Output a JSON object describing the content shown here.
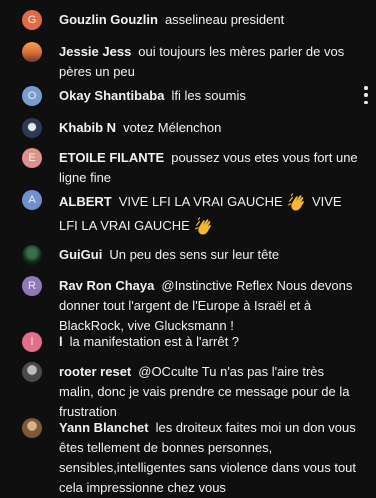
{
  "chat": {
    "messages": [
      {
        "author": "Gouzlin Gouzlin",
        "text": "asselineau president",
        "avatar_letter": "G",
        "avatar_color": "#e06b4a"
      },
      {
        "author": "Jessie Jess",
        "text": "oui toujours les mères parler de vos pères un peu",
        "avatar_letter": "",
        "avatar_color": "#d97a3a"
      },
      {
        "author": "Okay Shantibaba",
        "text": "lfi les soumis",
        "avatar_letter": "O",
        "avatar_color": "#7a9bd0"
      },
      {
        "author": "Khabib N",
        "text": "votez Mélenchon",
        "avatar_letter": "",
        "avatar_color": "#2b3a55"
      },
      {
        "author": "ETOILE FILANTE",
        "text": "poussez vous etes vous fort une ligne fine",
        "avatar_letter": "E",
        "avatar_color": "#e0928a"
      },
      {
        "author": "ALBERT",
        "text_a": "VIVE LFI LA VRAI GAUCHE",
        "text_b": "VIVE LFI LA VRAI GAUCHE",
        "avatar_letter": "A",
        "avatar_color": "#6f8fcf"
      },
      {
        "author": "GuiGui",
        "text": "Un peu des sens sur leur tête",
        "avatar_letter": "",
        "avatar_color": "#1f3a2b"
      },
      {
        "author": "Rav Ron Chaya",
        "text": "@Instinctive Reflex Nous devons donner tout l'argent de l'Europe à Israël et à BlackRock, vive Glucksmann !",
        "avatar_letter": "R",
        "avatar_color": "#8f7ab8"
      },
      {
        "author": "l",
        "text": "la manifestation est à l'arrêt ?",
        "avatar_letter": "l",
        "avatar_color": "#e0708a"
      },
      {
        "author": "rooter reset",
        "text": "@OCculte Tu n'as pas l'aire très malin, donc je vais prendre ce message pour de la frustration",
        "avatar_letter": "",
        "avatar_color": "#555555"
      },
      {
        "author": "Yann Blanchet",
        "text": "les droiteux faites moi un don vous êtes tellement de bonnes personnes, sensibles,intelligentes sans violence dans vous tout cela impressionne chez vous",
        "avatar_letter": "",
        "avatar_color": "#8a6a4a"
      }
    ]
  },
  "icons": {
    "menu": "more-vertical-icon",
    "emoji": "clapping-hands-emoji"
  }
}
